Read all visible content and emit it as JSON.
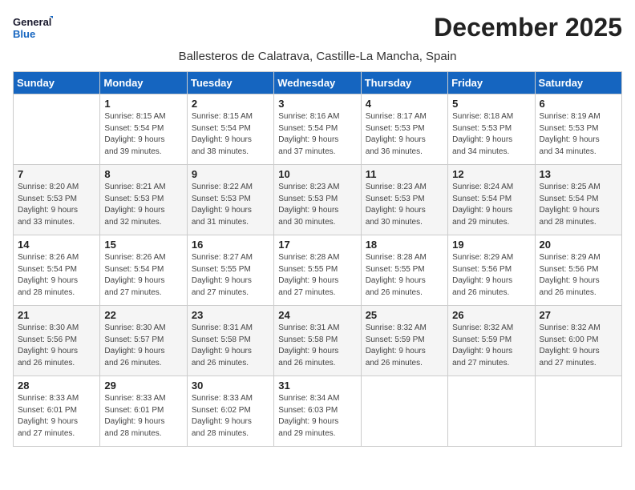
{
  "logo": {
    "line1": "General",
    "line2": "Blue"
  },
  "title": "December 2025",
  "subtitle": "Ballesteros de Calatrava, Castille-La Mancha, Spain",
  "days_of_week": [
    "Sunday",
    "Monday",
    "Tuesday",
    "Wednesday",
    "Thursday",
    "Friday",
    "Saturday"
  ],
  "weeks": [
    [
      {
        "day": "",
        "info": ""
      },
      {
        "day": "1",
        "info": "Sunrise: 8:15 AM\nSunset: 5:54 PM\nDaylight: 9 hours\nand 39 minutes."
      },
      {
        "day": "2",
        "info": "Sunrise: 8:15 AM\nSunset: 5:54 PM\nDaylight: 9 hours\nand 38 minutes."
      },
      {
        "day": "3",
        "info": "Sunrise: 8:16 AM\nSunset: 5:54 PM\nDaylight: 9 hours\nand 37 minutes."
      },
      {
        "day": "4",
        "info": "Sunrise: 8:17 AM\nSunset: 5:53 PM\nDaylight: 9 hours\nand 36 minutes."
      },
      {
        "day": "5",
        "info": "Sunrise: 8:18 AM\nSunset: 5:53 PM\nDaylight: 9 hours\nand 34 minutes."
      },
      {
        "day": "6",
        "info": "Sunrise: 8:19 AM\nSunset: 5:53 PM\nDaylight: 9 hours\nand 34 minutes."
      }
    ],
    [
      {
        "day": "7",
        "info": "Sunrise: 8:20 AM\nSunset: 5:53 PM\nDaylight: 9 hours\nand 33 minutes."
      },
      {
        "day": "8",
        "info": "Sunrise: 8:21 AM\nSunset: 5:53 PM\nDaylight: 9 hours\nand 32 minutes."
      },
      {
        "day": "9",
        "info": "Sunrise: 8:22 AM\nSunset: 5:53 PM\nDaylight: 9 hours\nand 31 minutes."
      },
      {
        "day": "10",
        "info": "Sunrise: 8:23 AM\nSunset: 5:53 PM\nDaylight: 9 hours\nand 30 minutes."
      },
      {
        "day": "11",
        "info": "Sunrise: 8:23 AM\nSunset: 5:53 PM\nDaylight: 9 hours\nand 30 minutes."
      },
      {
        "day": "12",
        "info": "Sunrise: 8:24 AM\nSunset: 5:54 PM\nDaylight: 9 hours\nand 29 minutes."
      },
      {
        "day": "13",
        "info": "Sunrise: 8:25 AM\nSunset: 5:54 PM\nDaylight: 9 hours\nand 28 minutes."
      }
    ],
    [
      {
        "day": "14",
        "info": "Sunrise: 8:26 AM\nSunset: 5:54 PM\nDaylight: 9 hours\nand 28 minutes."
      },
      {
        "day": "15",
        "info": "Sunrise: 8:26 AM\nSunset: 5:54 PM\nDaylight: 9 hours\nand 27 minutes."
      },
      {
        "day": "16",
        "info": "Sunrise: 8:27 AM\nSunset: 5:55 PM\nDaylight: 9 hours\nand 27 minutes."
      },
      {
        "day": "17",
        "info": "Sunrise: 8:28 AM\nSunset: 5:55 PM\nDaylight: 9 hours\nand 27 minutes."
      },
      {
        "day": "18",
        "info": "Sunrise: 8:28 AM\nSunset: 5:55 PM\nDaylight: 9 hours\nand 26 minutes."
      },
      {
        "day": "19",
        "info": "Sunrise: 8:29 AM\nSunset: 5:56 PM\nDaylight: 9 hours\nand 26 minutes."
      },
      {
        "day": "20",
        "info": "Sunrise: 8:29 AM\nSunset: 5:56 PM\nDaylight: 9 hours\nand 26 minutes."
      }
    ],
    [
      {
        "day": "21",
        "info": "Sunrise: 8:30 AM\nSunset: 5:56 PM\nDaylight: 9 hours\nand 26 minutes."
      },
      {
        "day": "22",
        "info": "Sunrise: 8:30 AM\nSunset: 5:57 PM\nDaylight: 9 hours\nand 26 minutes."
      },
      {
        "day": "23",
        "info": "Sunrise: 8:31 AM\nSunset: 5:58 PM\nDaylight: 9 hours\nand 26 minutes."
      },
      {
        "day": "24",
        "info": "Sunrise: 8:31 AM\nSunset: 5:58 PM\nDaylight: 9 hours\nand 26 minutes."
      },
      {
        "day": "25",
        "info": "Sunrise: 8:32 AM\nSunset: 5:59 PM\nDaylight: 9 hours\nand 26 minutes."
      },
      {
        "day": "26",
        "info": "Sunrise: 8:32 AM\nSunset: 5:59 PM\nDaylight: 9 hours\nand 27 minutes."
      },
      {
        "day": "27",
        "info": "Sunrise: 8:32 AM\nSunset: 6:00 PM\nDaylight: 9 hours\nand 27 minutes."
      }
    ],
    [
      {
        "day": "28",
        "info": "Sunrise: 8:33 AM\nSunset: 6:01 PM\nDaylight: 9 hours\nand 27 minutes."
      },
      {
        "day": "29",
        "info": "Sunrise: 8:33 AM\nSunset: 6:01 PM\nDaylight: 9 hours\nand 28 minutes."
      },
      {
        "day": "30",
        "info": "Sunrise: 8:33 AM\nSunset: 6:02 PM\nDaylight: 9 hours\nand 28 minutes."
      },
      {
        "day": "31",
        "info": "Sunrise: 8:34 AM\nSunset: 6:03 PM\nDaylight: 9 hours\nand 29 minutes."
      },
      {
        "day": "",
        "info": ""
      },
      {
        "day": "",
        "info": ""
      },
      {
        "day": "",
        "info": ""
      }
    ]
  ]
}
